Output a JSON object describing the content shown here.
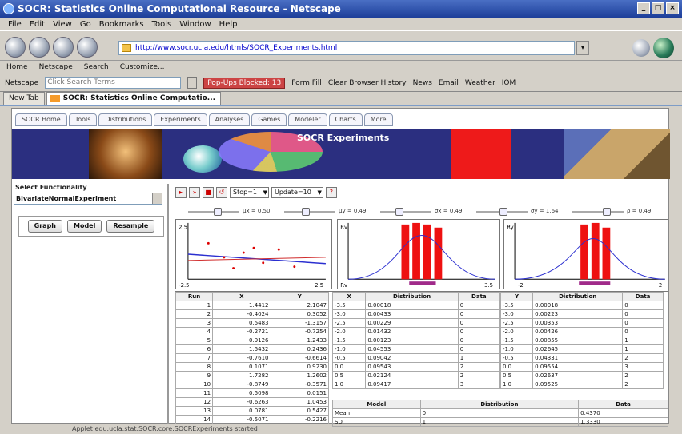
{
  "window": {
    "title": "SOCR: Statistics Online Computational Resource - Netscape",
    "buttons": [
      "_",
      "□",
      "×"
    ]
  },
  "menu": [
    "File",
    "Edit",
    "View",
    "Go",
    "Bookmarks",
    "Tools",
    "Window",
    "Help"
  ],
  "nav": {
    "url": "http://www.socr.ucla.edu/htmls/SOCR_Experiments.html"
  },
  "personal_bar": [
    "Home",
    "Netscape",
    "Search",
    "Customize..."
  ],
  "search_bar": {
    "engine": "Netscape",
    "placeholder": "Click Search Terms",
    "popups": "Pop-Ups Blocked: 13",
    "items": [
      "Form Fill",
      "Clear Browser History",
      "News",
      "Email",
      "Weather",
      "IOM"
    ]
  },
  "tabs": [
    {
      "label": "New Tab"
    },
    {
      "label": "SOCR: Statistics Online Computatio..."
    }
  ],
  "socr_nav": [
    "SOCR Home",
    "Tools",
    "Distributions",
    "Experiments",
    "Analyses",
    "Games",
    "Modeler",
    "Charts",
    "More"
  ],
  "banner": {
    "title": "SOCR Experiments"
  },
  "left_panel": {
    "title": "Select Functionality",
    "selected_experiment": "BivariateNormalExperiment",
    "buttons": [
      "Graph",
      "Model",
      "Resample"
    ]
  },
  "controls": {
    "steps_select": "Stop=1",
    "update_select": "Update=10"
  },
  "sliders": [
    {
      "label": "μx = 0.50",
      "value": 0.5
    },
    {
      "label": "μy = 0.49",
      "value": 0.35
    },
    {
      "label": "σx = 0.49",
      "value": 0.3
    },
    {
      "label": "σy = 1.64",
      "value": 0.45
    },
    {
      "label": "ρ = 0.49",
      "value": 0.6
    }
  ],
  "plots": {
    "scatter": {
      "ymax": "2.5",
      "xmin": "-2.5",
      "xmax": "2.5"
    },
    "hist1": {
      "label": "Rv",
      "xmin": "Rv",
      "xmax": "3.5"
    },
    "hist2": {
      "label": "Ry",
      "xmin": "-2",
      "xmax": "2"
    }
  },
  "table_sample": {
    "headers": [
      "Run",
      "X",
      "Y"
    ],
    "rows": [
      [
        "1",
        "1.4412",
        "2.1047"
      ],
      [
        "2",
        "-0.4024",
        "0.3052"
      ],
      [
        "3",
        "0.5483",
        "-1.3157"
      ],
      [
        "4",
        "-0.2721",
        "-0.7254"
      ],
      [
        "5",
        "0.9126",
        "1.2433"
      ],
      [
        "6",
        "1.5432",
        "0.2436"
      ],
      [
        "7",
        "-0.7610",
        "-0.6614"
      ],
      [
        "8",
        "0.1071",
        "0.9230"
      ],
      [
        "9",
        "1.7282",
        "1.2602"
      ],
      [
        "10",
        "-0.8749",
        "-0.3571"
      ],
      [
        "11",
        "0.5098",
        "0.0151"
      ],
      [
        "12",
        "-0.6263",
        "1.0453"
      ],
      [
        "13",
        "0.0781",
        "0.5427"
      ],
      [
        "14",
        "-0.5071",
        "-0.2216"
      ]
    ]
  },
  "table_dist_x": {
    "headers": [
      "X",
      "Distribution",
      "Data"
    ],
    "rows": [
      [
        "-3.5",
        "0.00018",
        "0"
      ],
      [
        "-3.0",
        "0.00433",
        "0"
      ],
      [
        "-2.5",
        "0.00229",
        "0"
      ],
      [
        "-2.0",
        "0.01432",
        "0"
      ],
      [
        "-1.5",
        "0.00123",
        "0"
      ],
      [
        "-1.0",
        "0.04553",
        "0"
      ],
      [
        "-0.5",
        "0.09042",
        "1"
      ],
      [
        "0.0",
        "0.09543",
        "2"
      ],
      [
        "0.5",
        "0.02124",
        "2"
      ],
      [
        "1.0",
        "0.09417",
        "3"
      ]
    ]
  },
  "table_dist_y": {
    "headers": [
      "Y",
      "Distribution",
      "Data"
    ],
    "rows": [
      [
        "-3.5",
        "0.00018",
        "0"
      ],
      [
        "-3.0",
        "0.00223",
        "0"
      ],
      [
        "-2.5",
        "0.00353",
        "0"
      ],
      [
        "-2.0",
        "0.00426",
        "0"
      ],
      [
        "-1.5",
        "0.00855",
        "1"
      ],
      [
        "-1.0",
        "0.02645",
        "1"
      ],
      [
        "-0.5",
        "0.04331",
        "2"
      ],
      [
        "0.0",
        "0.09554",
        "3"
      ],
      [
        "0.5",
        "0.02637",
        "2"
      ],
      [
        "1.0",
        "0.09525",
        "2"
      ]
    ]
  },
  "summary": {
    "headers": [
      "Model",
      "Distribution",
      "Data"
    ],
    "rows": [
      [
        "Mean",
        "0",
        "0.4370"
      ],
      [
        "SD",
        "1",
        "1.3330"
      ]
    ]
  },
  "status_bar": "Applet edu.ucla.stat.SOCR.core.SOCRExperiments started"
}
